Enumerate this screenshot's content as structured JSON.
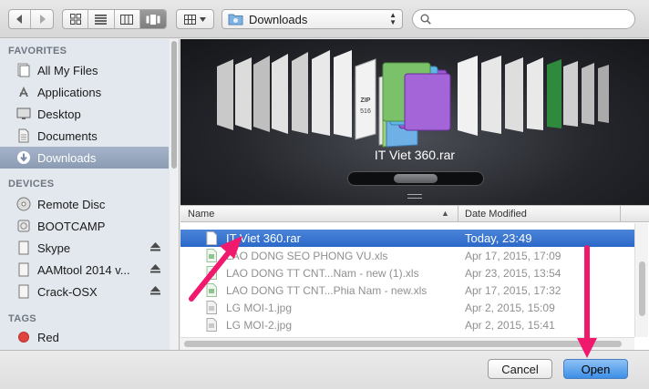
{
  "toolbar": {
    "location": "Downloads",
    "icons": {
      "back": "chevron-left-icon",
      "forward": "chevron-right-icon",
      "views": [
        "icon-view-icon",
        "list-view-icon",
        "column-view-icon",
        "coverflow-view-icon"
      ],
      "arrange": "arrange-grid-icon",
      "folder": "folder-icon",
      "search": "magnifier-icon"
    }
  },
  "sidebar": {
    "favorites_header": "FAVORITES",
    "favorites": [
      {
        "label": "All My Files",
        "icon": "all-files-icon"
      },
      {
        "label": "Applications",
        "icon": "applications-icon"
      },
      {
        "label": "Desktop",
        "icon": "desktop-icon"
      },
      {
        "label": "Documents",
        "icon": "documents-icon"
      },
      {
        "label": "Downloads",
        "icon": "downloads-icon",
        "selected": true
      }
    ],
    "devices_header": "DEVICES",
    "devices": [
      {
        "label": "Remote Disc",
        "icon": "disc-icon"
      },
      {
        "label": "BOOTCAMP",
        "icon": "drive-icon"
      },
      {
        "label": "Skype",
        "icon": "volume-icon",
        "eject": true
      },
      {
        "label": "AAMtool 2014 v...",
        "icon": "volume-icon",
        "eject": true
      },
      {
        "label": "Crack-OSX",
        "icon": "volume-icon",
        "eject": true
      }
    ],
    "tags_header": "TAGS",
    "tags": [
      {
        "label": "Red",
        "color": "#e0443e"
      }
    ]
  },
  "preview": {
    "title": "IT Viet 360.rar",
    "zip_label": "ZIP",
    "zip_sub": "516"
  },
  "list": {
    "col_name": "Name",
    "col_date": "Date Modified",
    "rows": [
      {
        "name": "",
        "date": ""
      },
      {
        "name": "IT Viet 360.rar",
        "date": "Today, 23:49",
        "selected": true
      },
      {
        "name": "LAO DONG SEO PHONG VU.xls",
        "date": "Apr 17, 2015, 17:09"
      },
      {
        "name": "LAO DONG TT CNT...Nam - new (1).xls",
        "date": "Apr 23, 2015, 13:54"
      },
      {
        "name": "LAO DONG TT CNT...Phia Nam - new.xls",
        "date": "Apr 17, 2015, 17:32"
      },
      {
        "name": "LG MOI-1.jpg",
        "date": "Apr 2, 2015, 15:09"
      },
      {
        "name": "LG MOI-2.jpg",
        "date": "Apr 2, 2015, 15:41"
      }
    ]
  },
  "buttons": {
    "cancel": "Cancel",
    "open": "Open"
  },
  "colors": {
    "selection": "#2f6dcb",
    "annotation": "#f0196e"
  }
}
